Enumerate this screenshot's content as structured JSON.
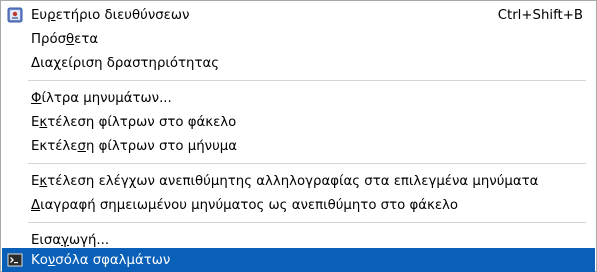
{
  "menu": {
    "items": [
      {
        "pre": "Ευ",
        "acc": "ρ",
        "post": "ετήριο διευθύνσεων",
        "shortcut": "Ctrl+Shift+B",
        "icon": "address-book-icon"
      },
      {
        "pre": "Πρόσ",
        "acc": "θ",
        "post": "ετα"
      },
      {
        "pre": "Δια",
        "acc": "χ",
        "post": "είριση δραστηριότητας"
      },
      {
        "pre": "",
        "acc": "Φ",
        "post": "ίλτρα μηνυμάτων..."
      },
      {
        "pre": "Ε",
        "acc": "κ",
        "post": "τέλεση φίλτρων στο φάκελο"
      },
      {
        "pre": "Εκτέλε",
        "acc": "σ",
        "post": "η φίλτρων στο μήνυμα"
      },
      {
        "pre": "Ε",
        "acc": "κ",
        "post": "τέλεση ελέγχων ανεπιθύμητης αλληλογραφίας στα επιλεγμένα μηνύματα"
      },
      {
        "pre": "",
        "acc": "Δ",
        "post": "ιαγραφή σημειωμένου μηνύματος ως ανεπιθύμητο στο φάκελο"
      },
      {
        "pre": "Εισα",
        "acc": "γ",
        "post": "ωγή..."
      },
      {
        "pre": "Κο",
        "acc": "ν",
        "post": "σόλα σφαλμάτων",
        "icon": "terminal-icon"
      }
    ]
  }
}
